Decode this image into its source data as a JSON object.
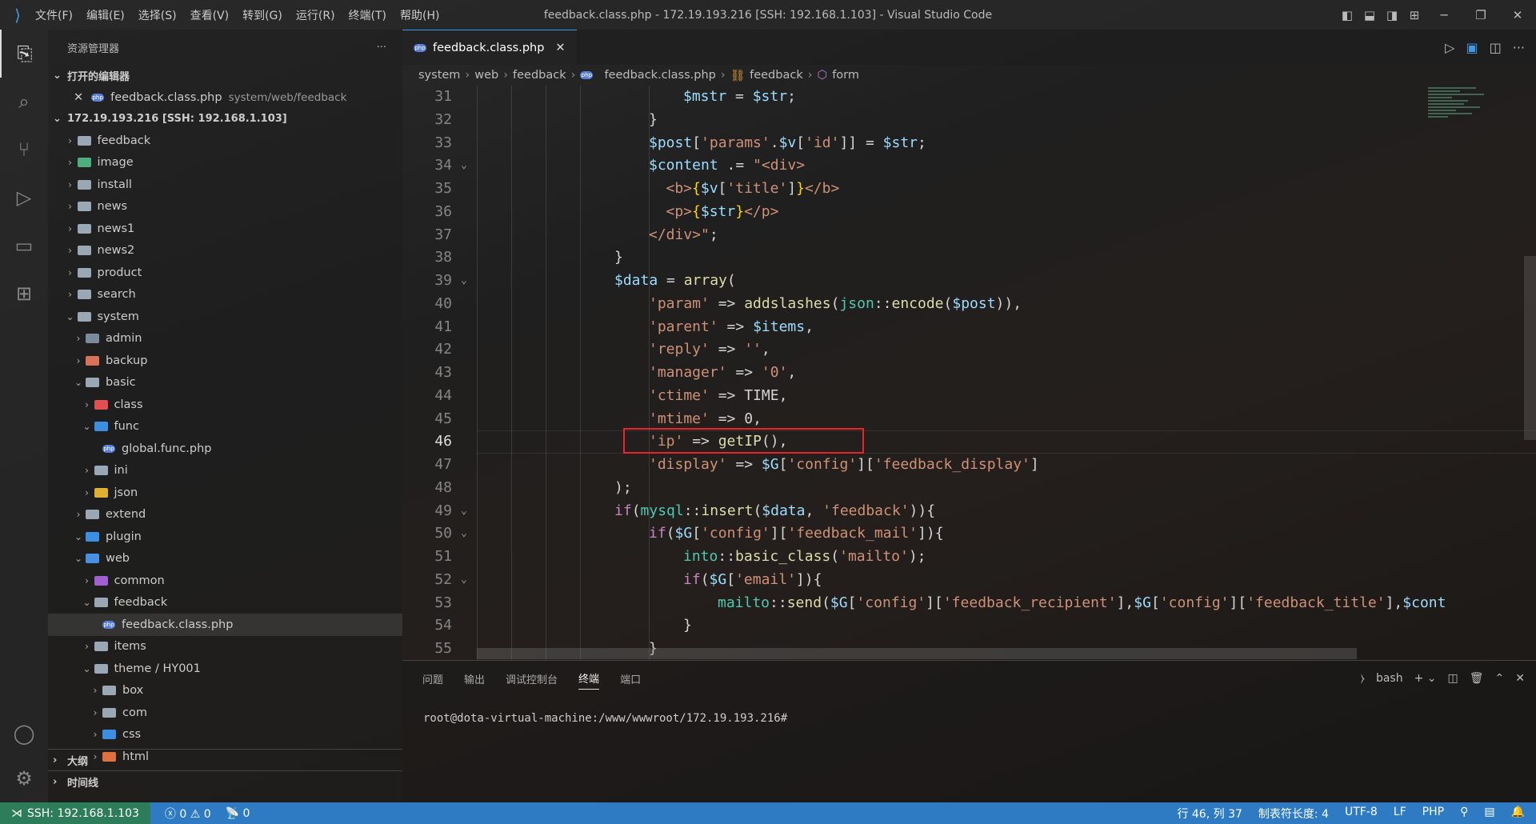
{
  "window": {
    "title": "feedback.class.php - 172.19.193.216 [SSH: 192.168.1.103] - Visual Studio Code"
  },
  "menu": [
    "文件(F)",
    "编辑(E)",
    "选择(S)",
    "查看(V)",
    "转到(G)",
    "运行(R)",
    "终端(T)",
    "帮助(H)"
  ],
  "sidebar": {
    "title": "资源管理器",
    "open_editors": "打开的编辑器",
    "open_file": {
      "name": "feedback.class.php",
      "path": "system/web/feedback"
    },
    "root": "172.19.193.216 [SSH: 192.168.1.103]",
    "tree": [
      {
        "name": "feedback",
        "level": 1,
        "type": "folder",
        "open": false
      },
      {
        "name": "image",
        "level": 1,
        "type": "folder-image",
        "open": false
      },
      {
        "name": "install",
        "level": 1,
        "type": "folder",
        "open": false
      },
      {
        "name": "news",
        "level": 1,
        "type": "folder",
        "open": false
      },
      {
        "name": "news1",
        "level": 1,
        "type": "folder",
        "open": false
      },
      {
        "name": "news2",
        "level": 1,
        "type": "folder",
        "open": false
      },
      {
        "name": "product",
        "level": 1,
        "type": "folder",
        "open": false
      },
      {
        "name": "search",
        "level": 1,
        "type": "folder",
        "open": false
      },
      {
        "name": "system",
        "level": 1,
        "type": "folder",
        "open": true
      },
      {
        "name": "admin",
        "level": 2,
        "type": "folder-admin",
        "open": false
      },
      {
        "name": "backup",
        "level": 2,
        "type": "folder-backup",
        "open": false
      },
      {
        "name": "basic",
        "level": 2,
        "type": "folder",
        "open": true
      },
      {
        "name": "class",
        "level": 3,
        "type": "folder-class",
        "open": false
      },
      {
        "name": "func",
        "level": 3,
        "type": "folder-func",
        "open": true
      },
      {
        "name": "global.func.php",
        "level": 4,
        "type": "php-file"
      },
      {
        "name": "ini",
        "level": 3,
        "type": "folder",
        "open": false
      },
      {
        "name": "json",
        "level": 3,
        "type": "folder-json",
        "open": false
      },
      {
        "name": "extend",
        "level": 2,
        "type": "folder",
        "open": false
      },
      {
        "name": "plugin",
        "level": 2,
        "type": "folder-plugin",
        "open": true
      },
      {
        "name": "web",
        "level": 2,
        "type": "folder-web",
        "open": true
      },
      {
        "name": "common",
        "level": 3,
        "type": "folder-common",
        "open": false
      },
      {
        "name": "feedback",
        "level": 3,
        "type": "folder",
        "open": true
      },
      {
        "name": "feedback.class.php",
        "level": 4,
        "type": "php-file",
        "selected": true
      },
      {
        "name": "items",
        "level": 3,
        "type": "folder",
        "open": false
      },
      {
        "name": "theme / HY001",
        "level": 3,
        "type": "folder",
        "open": true
      },
      {
        "name": "box",
        "level": 4,
        "type": "folder",
        "open": false
      },
      {
        "name": "com",
        "level": 4,
        "type": "folder",
        "open": false
      },
      {
        "name": "css",
        "level": 4,
        "type": "folder-css",
        "open": false
      },
      {
        "name": "html",
        "level": 4,
        "type": "folder-html",
        "open": false
      }
    ],
    "outline": "大纲",
    "timeline": "时间线"
  },
  "editor": {
    "tab": "feedback.class.php",
    "breadcrumb": [
      "system",
      "web",
      "feedback",
      "feedback.class.php",
      "feedback",
      "form"
    ],
    "current_line": 46,
    "lines": [
      {
        "n": 31,
        "i": 6,
        "t": [
          [
            "v",
            "$mstr"
          ],
          [
            "p",
            " = "
          ],
          [
            "v",
            "$str"
          ],
          [
            "p",
            ";"
          ]
        ]
      },
      {
        "n": 32,
        "i": 5,
        "t": [
          [
            "p",
            "}"
          ]
        ]
      },
      {
        "n": 33,
        "i": 5,
        "t": [
          [
            "v",
            "$post"
          ],
          [
            "p",
            "["
          ],
          [
            "s",
            "'params'"
          ],
          [
            "p",
            "."
          ],
          [
            "v",
            "$v"
          ],
          [
            "p",
            "["
          ],
          [
            "s",
            "'id'"
          ],
          [
            "p",
            "]] = "
          ],
          [
            "v",
            "$str"
          ],
          [
            "p",
            ";"
          ]
        ]
      },
      {
        "n": 34,
        "i": 5,
        "fold": true,
        "t": [
          [
            "v",
            "$content"
          ],
          [
            "p",
            " .= "
          ],
          [
            "s",
            "\"<div>"
          ]
        ]
      },
      {
        "n": 35,
        "i": 5.5,
        "t": [
          [
            "s",
            "<b>"
          ],
          [
            "b",
            "{"
          ],
          [
            "v",
            "$v"
          ],
          [
            "p",
            "["
          ],
          [
            "s",
            "'title'"
          ],
          [
            "p",
            "]"
          ],
          [
            "b",
            "}"
          ],
          [
            "s",
            "</b>"
          ]
        ]
      },
      {
        "n": 36,
        "i": 5.5,
        "t": [
          [
            "s",
            "<p>"
          ],
          [
            "b",
            "{"
          ],
          [
            "v",
            "$str"
          ],
          [
            "b",
            "}"
          ],
          [
            "s",
            "</p>"
          ]
        ]
      },
      {
        "n": 37,
        "i": 5,
        "t": [
          [
            "s",
            "</div>\""
          ],
          [
            "p",
            ";"
          ]
        ]
      },
      {
        "n": 38,
        "i": 4,
        "t": [
          [
            "p",
            "}"
          ]
        ]
      },
      {
        "n": 39,
        "i": 4,
        "fold": true,
        "t": [
          [
            "v",
            "$data"
          ],
          [
            "p",
            " = "
          ],
          [
            "f",
            "array"
          ],
          [
            "p",
            "("
          ]
        ]
      },
      {
        "n": 40,
        "i": 5,
        "t": [
          [
            "s",
            "'param'"
          ],
          [
            "p",
            " => "
          ],
          [
            "f",
            "addslashes"
          ],
          [
            "p",
            "("
          ],
          [
            "c",
            "json"
          ],
          [
            "p",
            "::"
          ],
          [
            "f",
            "encode"
          ],
          [
            "p",
            "("
          ],
          [
            "v",
            "$post"
          ],
          [
            "p",
            ")),"
          ]
        ]
      },
      {
        "n": 41,
        "i": 5,
        "t": [
          [
            "s",
            "'parent'"
          ],
          [
            "p",
            " => "
          ],
          [
            "v",
            "$items"
          ],
          [
            "p",
            ","
          ]
        ]
      },
      {
        "n": 42,
        "i": 5,
        "t": [
          [
            "s",
            "'reply'"
          ],
          [
            "p",
            " => "
          ],
          [
            "s",
            "''"
          ],
          [
            "p",
            ","
          ]
        ]
      },
      {
        "n": 43,
        "i": 5,
        "t": [
          [
            "s",
            "'manager'"
          ],
          [
            "p",
            " => "
          ],
          [
            "s",
            "'0'"
          ],
          [
            "p",
            ","
          ]
        ]
      },
      {
        "n": 44,
        "i": 5,
        "t": [
          [
            "s",
            "'ctime'"
          ],
          [
            "p",
            " => "
          ],
          [
            "p",
            "TIME"
          ],
          [
            "p",
            ","
          ]
        ]
      },
      {
        "n": 45,
        "i": 5,
        "t": [
          [
            "s",
            "'mtime'"
          ],
          [
            "p",
            " => "
          ],
          [
            "p",
            "0"
          ],
          [
            "p",
            ","
          ]
        ]
      },
      {
        "n": 46,
        "i": 5,
        "t": [
          [
            "s",
            "'ip'"
          ],
          [
            "p",
            " => "
          ],
          [
            "f",
            "getIP"
          ],
          [
            "p",
            "(),"
          ]
        ]
      },
      {
        "n": 47,
        "i": 5,
        "t": [
          [
            "s",
            "'display'"
          ],
          [
            "p",
            " => "
          ],
          [
            "v",
            "$G"
          ],
          [
            "p",
            "["
          ],
          [
            "s",
            "'config'"
          ],
          [
            "p",
            "]["
          ],
          [
            "s",
            "'feedback_display'"
          ],
          [
            "p",
            "]"
          ]
        ]
      },
      {
        "n": 48,
        "i": 4,
        "t": [
          [
            "p",
            ");"
          ]
        ]
      },
      {
        "n": 49,
        "i": 4,
        "fold": true,
        "t": [
          [
            "k",
            "if"
          ],
          [
            "p",
            "("
          ],
          [
            "c",
            "mysql"
          ],
          [
            "p",
            "::"
          ],
          [
            "f",
            "insert"
          ],
          [
            "p",
            "("
          ],
          [
            "v",
            "$data"
          ],
          [
            "p",
            ", "
          ],
          [
            "s",
            "'feedback'"
          ],
          [
            "p",
            ")){"
          ]
        ]
      },
      {
        "n": 50,
        "i": 5,
        "fold": true,
        "t": [
          [
            "k",
            "if"
          ],
          [
            "p",
            "("
          ],
          [
            "v",
            "$G"
          ],
          [
            "p",
            "["
          ],
          [
            "s",
            "'config'"
          ],
          [
            "p",
            "]["
          ],
          [
            "s",
            "'feedback_mail'"
          ],
          [
            "p",
            "]){"
          ]
        ]
      },
      {
        "n": 51,
        "i": 6,
        "t": [
          [
            "c",
            "into"
          ],
          [
            "p",
            "::"
          ],
          [
            "f",
            "basic_class"
          ],
          [
            "p",
            "("
          ],
          [
            "s",
            "'mailto'"
          ],
          [
            "p",
            ");"
          ]
        ]
      },
      {
        "n": 52,
        "i": 6,
        "fold": true,
        "t": [
          [
            "k",
            "if"
          ],
          [
            "p",
            "("
          ],
          [
            "v",
            "$G"
          ],
          [
            "p",
            "["
          ],
          [
            "s",
            "'email'"
          ],
          [
            "p",
            "]){"
          ]
        ]
      },
      {
        "n": 53,
        "i": 7,
        "t": [
          [
            "c",
            "mailto"
          ],
          [
            "p",
            "::"
          ],
          [
            "f",
            "send"
          ],
          [
            "p",
            "("
          ],
          [
            "v",
            "$G"
          ],
          [
            "p",
            "["
          ],
          [
            "s",
            "'config'"
          ],
          [
            "p",
            "]["
          ],
          [
            "s",
            "'feedback_recipient'"
          ],
          [
            "p",
            "],"
          ],
          [
            "v",
            "$G"
          ],
          [
            "p",
            "["
          ],
          [
            "s",
            "'config'"
          ],
          [
            "p",
            "]["
          ],
          [
            "s",
            "'feedback_title'"
          ],
          [
            "p",
            "],"
          ],
          [
            "v",
            "$cont"
          ]
        ]
      },
      {
        "n": 54,
        "i": 6,
        "t": [
          [
            "p",
            "}"
          ]
        ]
      },
      {
        "n": 55,
        "i": 5,
        "t": [
          [
            "p",
            "}"
          ]
        ]
      }
    ]
  },
  "panel": {
    "tabs": [
      "问题",
      "输出",
      "调试控制台",
      "终端",
      "端口"
    ],
    "active": "终端",
    "shell": "bash",
    "prompt": "root@dota-virtual-machine:/www/wwwroot/172.19.193.216#"
  },
  "status": {
    "remote": "SSH: 192.168.1.103",
    "errors": "0",
    "warnings": "0",
    "ports": "0",
    "position": "行 46, 列 37",
    "indent": "制表符长度: 4",
    "encoding": "UTF-8",
    "eol": "LF",
    "language": "PHP"
  },
  "colors": {
    "accent": "#3c9be8",
    "statusbar": "#2e7bc4",
    "remote": "#2d7d5a",
    "highlight_box": "#e8242c"
  }
}
